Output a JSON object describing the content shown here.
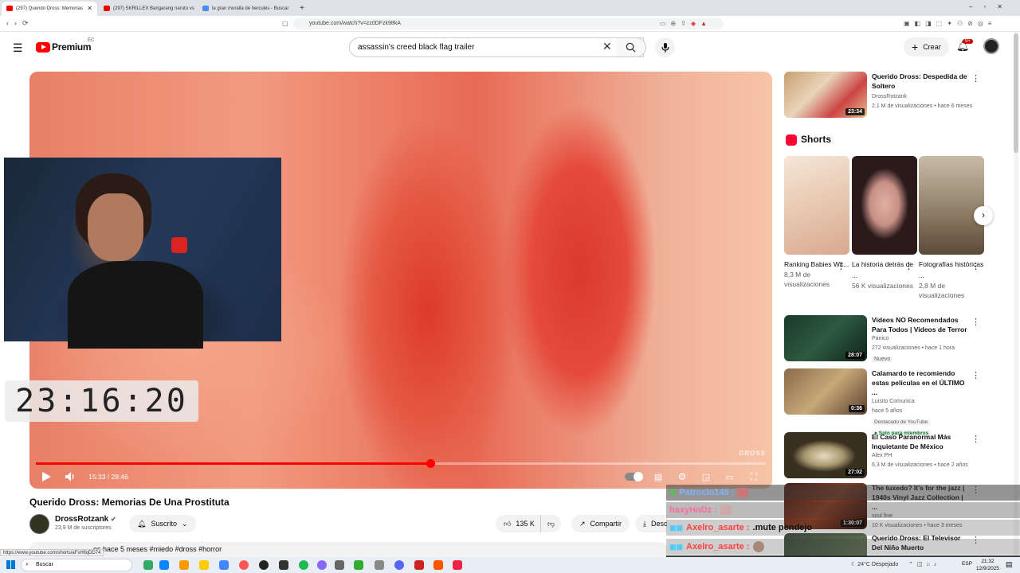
{
  "browser": {
    "tabs": [
      {
        "label": "(297) Querido Dross: Memorias",
        "active": true
      },
      {
        "label": "(297) SKRILLEX Bangarang naruto vs",
        "active": false
      },
      {
        "label": "la gran muralla de hercules - Buscar",
        "active": false
      }
    ],
    "url": "youtube.com/watch?v=zz0DFzk98kA"
  },
  "header": {
    "logo_text": "Premium",
    "region": "EC",
    "search_value": "assassin's creed black flag trailer",
    "create_label": "Crear",
    "notif_count": "9+"
  },
  "player": {
    "time": "15:33 / 28:46",
    "progress": 0.54,
    "watermark": "DROSS",
    "overlay_clock": "23:16:20"
  },
  "video": {
    "title": "Querido Dross: Memorias De Una Prostituta",
    "channel": "DrossRotzank",
    "subscribers": "23,9 M de suscriptores",
    "subscribed_label": "Suscrito",
    "likes": "135 K",
    "share_label": "Compartir",
    "download_label": "Descargar",
    "desc_line": "hace 5 meses  #miedo #dross #horror",
    "desc_prefix": "es",
    "status_url": "https://www.youtube.com/shorts/aFsHfiqDD74"
  },
  "sidebar": {
    "top_video": {
      "title": "Querido Dross: Despedida de Soltero",
      "channel": "DrossRotzank",
      "meta": "2,1 M de visualizaciones • hace 6 meses",
      "duration": "23:34"
    },
    "shorts_heading": "Shorts",
    "shorts": [
      {
        "title": "Ranking Babies Wit...",
        "views": "8,3 M de visualizaciones"
      },
      {
        "title": "La historia detrás de ...",
        "views": "56 K visualizaciones"
      },
      {
        "title": "Fotografías históricas ...",
        "views": "2,8 M de visualizaciones"
      }
    ],
    "videos": [
      {
        "title": "Videos NO Recomendados Para Todos | Videos de Terror",
        "channel": "Panico",
        "meta": "272 visualizaciones • hace 1 hora",
        "badge": "Nuevo",
        "duration": "28:07"
      },
      {
        "title": "Calamardo te recomiendo estas películas en el ÚLTIMO ...",
        "channel": "Luisito Comunica",
        "meta": "hace 5 años",
        "badge": "Destacado de YouTube",
        "badge2": "Solo para miembros",
        "duration": "0:36"
      },
      {
        "title": "El Caso Paranormal Más Inquietante De México",
        "channel": "Alex PH",
        "meta": "6,3 M de visualizaciones • hace 2 años",
        "duration": "27:02"
      },
      {
        "title": "The tuxedo? It's for the jazz | 1940s Vinyl Jazz Collection | ...",
        "channel": "soul fine",
        "meta": "10 K visualizaciones • hace 3 meses",
        "duration": "1:30:07"
      },
      {
        "title": "Querido Dross: El Televisor Del Niño Muerto",
        "channel": "",
        "meta": "",
        "duration": ""
      }
    ]
  },
  "chat": [
    {
      "user": "Patroclo145 :",
      "msg": "",
      "color": "#7fb3ff"
    },
    {
      "user": "haxyHnDz :",
      "msg": "",
      "color": "#ff6aa0"
    },
    {
      "user": "Axelro_asarte :",
      "msg": ".mute pendejo",
      "color": "#ff4040"
    },
    {
      "user": "Axelro_asarte :",
      "msg": "",
      "color": "#ff4040"
    },
    {
      "user": "ManubrioSSJ :",
      "msg": "mute",
      "color": "#ffffff"
    }
  ],
  "taskbar": {
    "search_label": "Buscar",
    "weather": "24°C  Despejado",
    "lang": "ESP",
    "time": "21:32",
    "date": "12/9/2025"
  }
}
